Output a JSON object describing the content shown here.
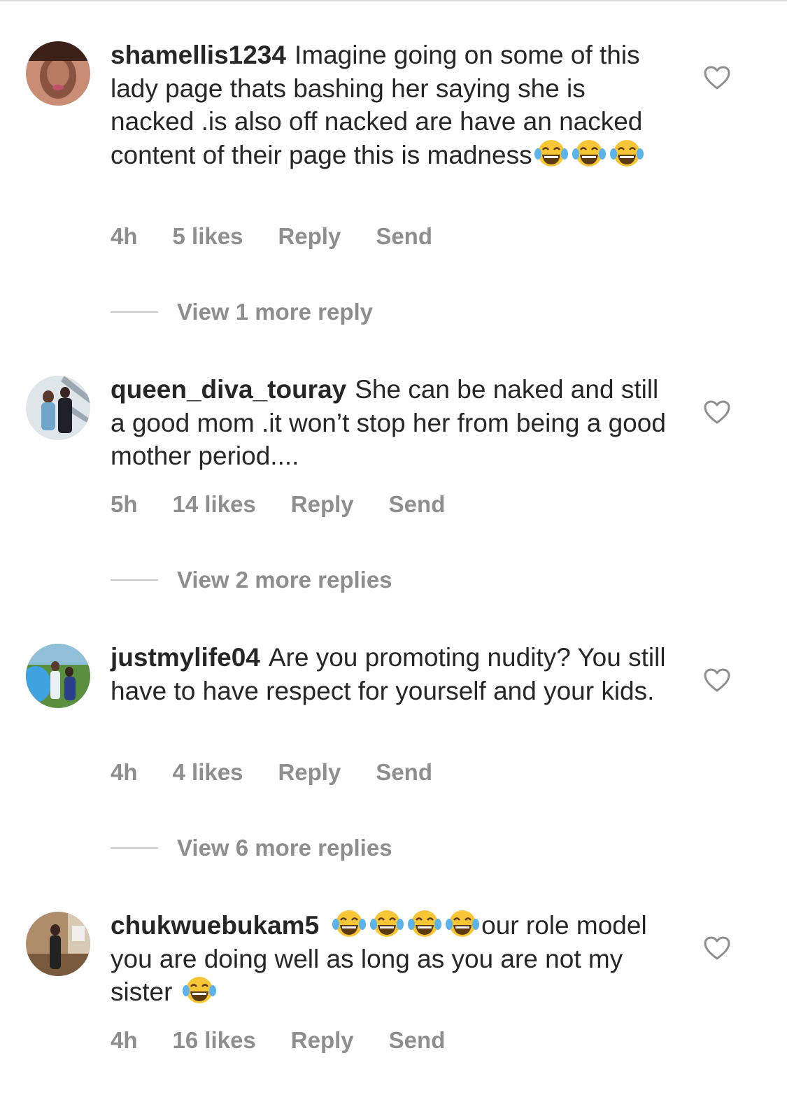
{
  "comments": [
    {
      "username": "shamellis1234",
      "text": "Imagine going on some of this lady page thats bashing her saying she is nacked .is also off nacked are have an nacked content of their page this is madness",
      "emoji_trail": "face-with-tears-of-joy x3",
      "time": "4h",
      "likes": "5 likes",
      "reply_label": "Reply",
      "send_label": "Send",
      "view_replies": "View 1 more reply",
      "avatar_colors": [
        "#d9a58f",
        "#6b3a2a"
      ]
    },
    {
      "username": "queen_diva_touray",
      "text": "She can be naked and still a good mom .it won’t stop her from being a good mother period....",
      "time": "5h",
      "likes": "14 likes",
      "reply_label": "Reply",
      "send_label": "Send",
      "view_replies": "View 2 more replies",
      "avatar_colors": [
        "#cfd6dc",
        "#2b2f3a"
      ]
    },
    {
      "username": "justmylife04",
      "text": "Are you promoting nudity? You still have to have respect for yourself and your kids.",
      "time": "4h",
      "likes": "4 likes",
      "reply_label": "Reply",
      "send_label": "Send",
      "view_replies": "View 6 more replies",
      "avatar_colors": [
        "#4a9fd6",
        "#3d6b2f"
      ]
    },
    {
      "username": "chukwuebukam5",
      "text_before": "",
      "text_after_emoji": "our role model you are doing well as long as you are not my sister",
      "time": "4h",
      "likes": "16 likes",
      "reply_label": "Reply",
      "send_label": "Send",
      "avatar_colors": [
        "#a8866a",
        "#2a2a2a"
      ]
    }
  ],
  "icons": {
    "like": "heart-outline-icon",
    "emoji": "face-with-tears-of-joy"
  },
  "colors": {
    "text": "#262626",
    "meta": "#8e8e8e",
    "divider": "#c7c7c7"
  }
}
